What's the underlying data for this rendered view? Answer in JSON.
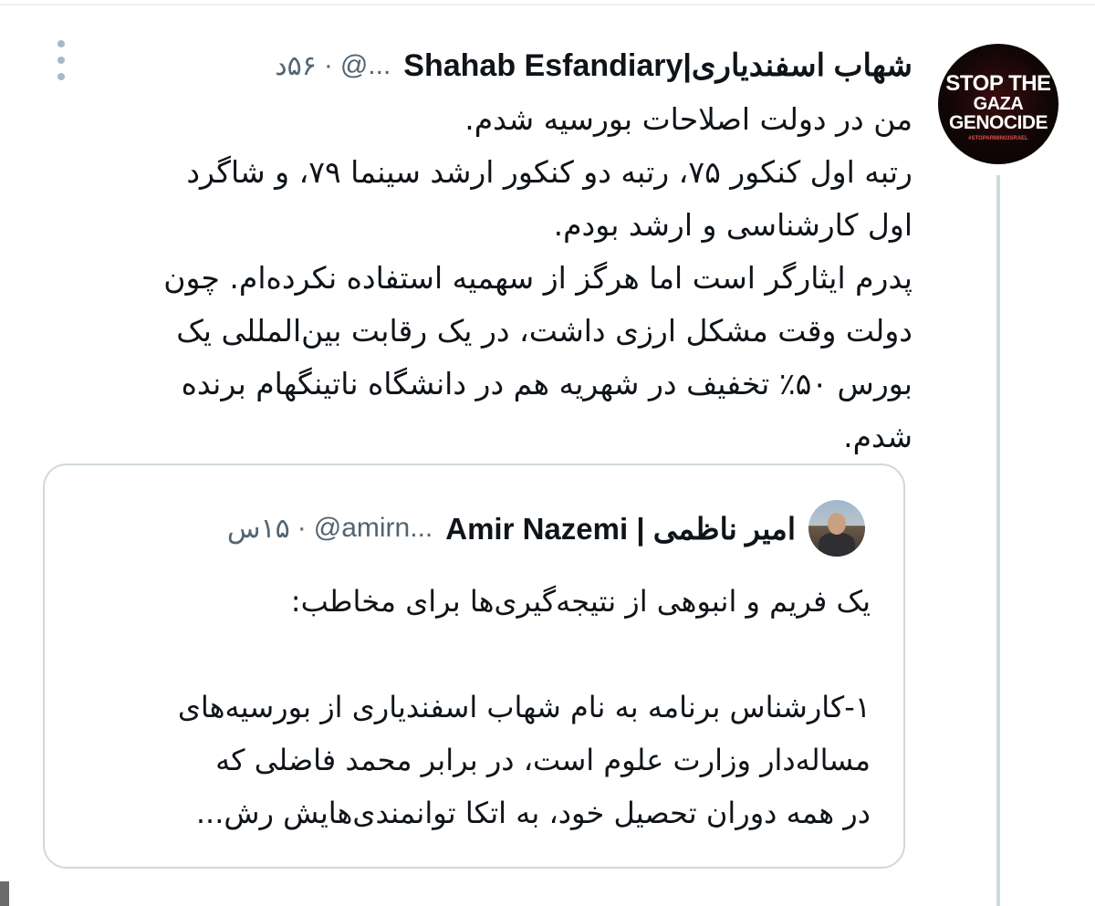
{
  "tweet": {
    "author_name": "شهاب اسفندیاری|Shahab Esfandiary",
    "handle": "@...",
    "separator": "·",
    "time": "۵۶د",
    "lines": [
      "من در دولت اصلاحات بورسیه شدم.",
      "رتبه اول کنکور ۷۵، رتبه دو کنکور ارشد سینما ۷۹، و شاگرد",
      "اول کارشناسی و ارشد بودم.",
      "پدرم ایثارگر است اما هرگز از سهمیه استفاده نکرده‌ام. چون",
      "دولت وقت مشکل ارزی داشت، در یک رقابت بین‌المللی یک",
      "بورس ۵۰٪ تخفیف در شهریه هم در دانشگاه ناتینگهام برنده",
      "شدم."
    ]
  },
  "avatar": {
    "line1": "STOP THE",
    "line2": "GAZA",
    "line3": "GENOCIDE",
    "tag": "#STOPARMINGISRAEL"
  },
  "quote": {
    "author_name": "امیر ناظمی | Amir Nazemi",
    "handle": "@amirn...",
    "separator": "·",
    "time": "۱۵س",
    "lines": [
      "یک فریم و انبوهی از نتیجه‌گیری‌ها برای مخاطب:",
      "",
      "۱-کارشناس برنامه به نام شهاب اسفندیاری از بورسیه‌های",
      "مساله‌دار وزارت علوم است، در برابر محمد فاضلی که",
      "در همه دوران تحصیل خود، به اتکا توانمندی‌هایش رش..."
    ]
  },
  "colors": {
    "text": "#0f1419",
    "secondary": "#536471",
    "border": "#cfd9de"
  }
}
